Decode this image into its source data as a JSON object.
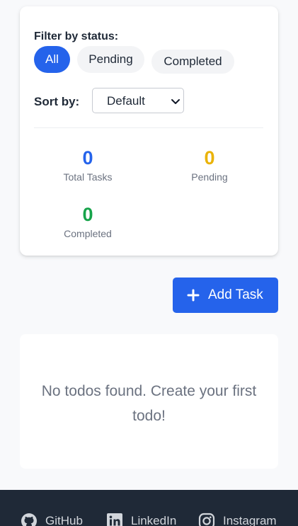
{
  "filter": {
    "label": "Filter by status:",
    "options": [
      {
        "label": "All",
        "active": true
      },
      {
        "label": "Pending",
        "active": false
      },
      {
        "label": "Completed",
        "active": false
      }
    ]
  },
  "sort": {
    "label": "Sort by:",
    "selected": "Default"
  },
  "stats": {
    "total": {
      "value": "0",
      "label": "Total Tasks",
      "color": "#2563eb"
    },
    "pending": {
      "value": "0",
      "label": "Pending",
      "color": "#eab308"
    },
    "completed": {
      "value": "0",
      "label": "Completed",
      "color": "#16a34a"
    }
  },
  "add_button": {
    "label": "Add Task",
    "icon": "plus-icon",
    "color": "#2563eb"
  },
  "empty_state": {
    "message": "No todos found. Create your first todo!"
  },
  "footer": {
    "links": [
      {
        "label": "GitHub",
        "icon": "github-icon"
      },
      {
        "label": "LinkedIn",
        "icon": "linkedin-icon"
      },
      {
        "label": "Instagram",
        "icon": "instagram-icon"
      }
    ]
  }
}
